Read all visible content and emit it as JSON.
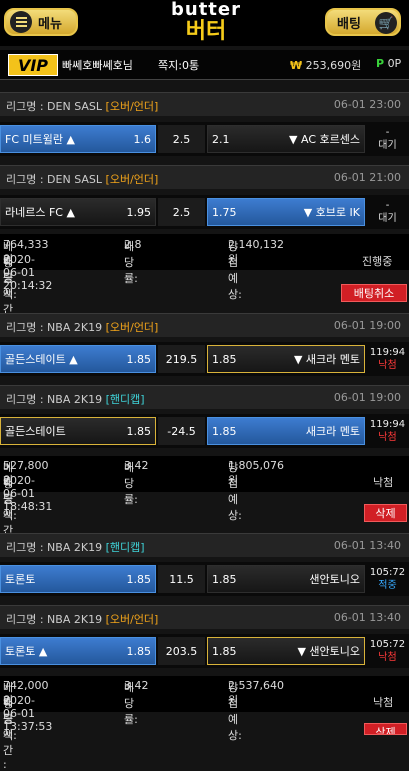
{
  "header": {
    "menu": "메뉴",
    "bet": "배팅",
    "logo_en": "butter",
    "logo_kr": "버터"
  },
  "user": {
    "vip": "VIP",
    "name": "빠쎄호빠쎄호님",
    "messages": "쪽지:0통",
    "won_sym": "₩",
    "balance": "253,690원",
    "pt_sym": "P",
    "points": "0P"
  },
  "labels": {
    "bet_amount": "베팅금액:",
    "odds": "배당률:",
    "expected": "당첨예상:",
    "bet_time": "배팅시간 :"
  },
  "bets": [
    {
      "league": "리그명 : DEN SASL",
      "tag": "[오버/언더]",
      "time": "06-01 23:00",
      "home": "FC 미트윌란 ▲",
      "home_odd": "1.6",
      "mid": "2.5",
      "away_odd": "2.1",
      "away": "▼ AC 호르센스",
      "status1": "-",
      "status2": "대기"
    },
    {
      "league": "리그명 : DEN SASL",
      "tag": "[오버/언더]",
      "time": "06-01 21:00",
      "home": "라네르스 FC ▲",
      "home_odd": "1.95",
      "mid": "2.5",
      "away_odd": "1.75",
      "away": "▼ 호브로 IK",
      "status1": "-",
      "status2": "대기",
      "amount": "764,333원",
      "odds": "2.8",
      "expected": "2,140,132원",
      "bettime": "2020-06-01 20:14:32",
      "result": "진행중",
      "button": "배팅취소"
    },
    {
      "league": "리그명 : NBA 2K19",
      "tag": "[오버/언더]",
      "time": "06-01 19:00",
      "home": "골든스테이트 ▲",
      "home_odd": "1.85",
      "mid": "219.5",
      "away_odd": "1.85",
      "away": "▼ 새크라 멘토",
      "status1": "119:94",
      "status2": "낙첨"
    },
    {
      "league": "리그명 : NBA 2K19",
      "tag": "[핸디캡]",
      "time": "06-01 19:00",
      "home": "골든스테이트",
      "home_odd": "1.85",
      "mid": "-24.5",
      "away_odd": "1.85",
      "away": "새크라 멘토",
      "status1": "119:94",
      "status2": "낙첨",
      "amount": "527,800원",
      "odds": "3.42",
      "expected": "1,805,076원",
      "bettime": "2020-06-01 18:48:31",
      "result": "낙첨",
      "button": "삭제"
    },
    {
      "league": "리그명 : NBA 2K19",
      "tag": "[핸디캡]",
      "time": "06-01 13:40",
      "home": "토론토",
      "home_odd": "1.85",
      "mid": "11.5",
      "away_odd": "1.85",
      "away": "샌안토니오",
      "status1": "105:72",
      "status2": "적중"
    },
    {
      "league": "리그명 : NBA 2K19",
      "tag": "[오버/언더]",
      "time": "06-01 13:40",
      "home": "토론토 ▲",
      "home_odd": "1.85",
      "mid": "203.5",
      "away_odd": "1.85",
      "away": "▼ 샌안토니오",
      "status1": "105:72",
      "status2": "낙첨",
      "amount": "742,000원",
      "odds": "3.42",
      "expected": "2,537,640원",
      "bettime": "2020-06-01 13:37:53",
      "result": "낙첨",
      "button": "삭제"
    }
  ]
}
